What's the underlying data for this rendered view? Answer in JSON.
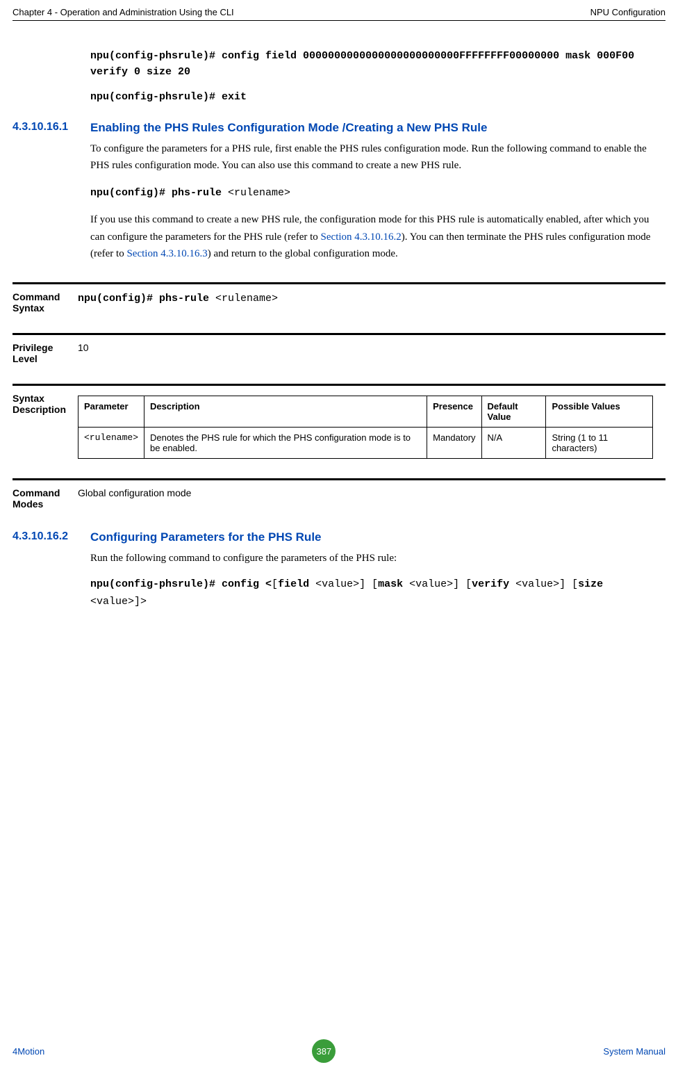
{
  "header": {
    "left": "Chapter 4 - Operation and Administration Using the CLI",
    "right": "NPU Configuration"
  },
  "top_code": {
    "line1": "npu(config-phsrule)# config field 0000000000000000000000000FFFFFFFF00000000 mask 000F00 verify 0 size 20",
    "line2": "npu(config-phsrule)# exit"
  },
  "sec1": {
    "num": "4.3.10.16.1",
    "title": "Enabling the PHS Rules Configuration Mode /Creating a New PHS Rule",
    "p1": "To configure the parameters for a PHS rule, first enable the PHS rules configuration mode. Run the following command to enable the PHS rules configuration mode. You can also use this command to create a new PHS rule.",
    "code_prefix": "npu(config)# phs-rule ",
    "code_arg": "<rulename>",
    "p2_a": "If you use this command to create a new PHS rule, the configuration mode for this PHS rule is automatically enabled, after which you can configure the parameters for the PHS rule (refer to ",
    "p2_link1": "Section 4.3.10.16.2",
    "p2_b": "). You can then terminate the PHS rules configuration mode (refer to ",
    "p2_link2": "Section 4.3.10.16.3",
    "p2_c": ") and return to the global configuration mode."
  },
  "cmd_syntax": {
    "label": "Command Syntax",
    "code_prefix": "npu(config)# phs-rule ",
    "code_arg": "<rulename>"
  },
  "priv_level": {
    "label": "Privilege Level",
    "value": "10"
  },
  "syntax_desc": {
    "label": "Syntax Description",
    "headers": {
      "c1": "Parameter",
      "c2": "Description",
      "c3": "Presence",
      "c4": "Default Value",
      "c5": "Possible Values"
    },
    "row": {
      "c1": "<rulename>",
      "c2": "Denotes the PHS rule for which the PHS configuration mode is to be enabled.",
      "c3": "Mandatory",
      "c4": "N/A",
      "c5": "String (1 to 11 characters)"
    }
  },
  "cmd_modes": {
    "label": "Command Modes",
    "value": "Global configuration mode"
  },
  "sec2": {
    "num": "4.3.10.16.2",
    "title": "Configuring Parameters for the PHS Rule",
    "p1": "Run the following command to configure the parameters of the PHS rule:",
    "code_b1": "npu(config-phsrule)# config <",
    "code_p1": "[",
    "code_b2": "field ",
    "code_p2": "<value>] [",
    "code_b3": "mask ",
    "code_p3": "<value>] [",
    "code_b4": "verify",
    "code_p4": " <value>] [",
    "code_b5": "size ",
    "code_p5": "<value>]>"
  },
  "footer": {
    "left": "4Motion",
    "center": "387",
    "right": " System Manual"
  }
}
